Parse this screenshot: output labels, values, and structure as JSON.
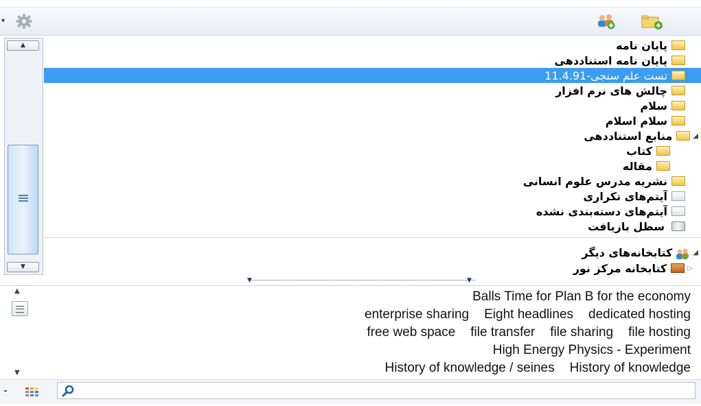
{
  "toolbar": {
    "icons": [
      "dropdown-arrow-icon",
      "gear-icon",
      "new-group-icon",
      "new-collection-icon"
    ]
  },
  "tree": {
    "items": [
      {
        "label": "پایان نامه",
        "icon": "folder-icon",
        "selected": false
      },
      {
        "label": "پایان نامه استناددهی",
        "icon": "folder-icon",
        "selected": false
      },
      {
        "label": "تست علم سنجی-11.4.91",
        "icon": "folder-icon",
        "selected": true
      },
      {
        "label": "چالش های نرم افزار",
        "icon": "folder-icon",
        "selected": false
      },
      {
        "label": "سلام",
        "icon": "folder-icon",
        "selected": false
      },
      {
        "label": "سلام اسلام",
        "icon": "folder-icon",
        "selected": false
      },
      {
        "label": "منابع استناددهی",
        "icon": "folder-icon",
        "selected": false,
        "expanded": true
      },
      {
        "label": "کتاب",
        "icon": "folder-icon",
        "selected": false,
        "indent": 1
      },
      {
        "label": "مقاله",
        "icon": "folder-icon",
        "selected": false,
        "indent": 1
      },
      {
        "label": "نشریه مدرس علوم انسانی",
        "icon": "folder-icon",
        "selected": false
      },
      {
        "label": "آیتم‌های تکراری",
        "icon": "duplicate-items-icon",
        "selected": false
      },
      {
        "label": "آیتم‌های دسته‌بندی نشده",
        "icon": "unfiled-items-icon",
        "selected": false
      },
      {
        "label": "سطل بازیافت",
        "icon": "trash-icon",
        "selected": false
      }
    ],
    "groups": [
      {
        "label": "کتابخانه‌های دیگر",
        "icon": "group-libraries-icon",
        "expanded": true
      },
      {
        "label": "کتابخانه مرکز نور",
        "icon": "library-icon",
        "expanded": false
      }
    ]
  },
  "tags": {
    "lines": [
      [
        "Balls Time for Plan B for the economy"
      ],
      [
        "enterprise sharing",
        "Eight headlines",
        "dedicated hosting"
      ],
      [
        "free web space",
        "file transfer",
        "file sharing",
        "file hosting"
      ],
      [
        "High Energy Physics - Experiment"
      ],
      [
        "History of knowledge / seines",
        "History of knowledge"
      ]
    ]
  },
  "search": {
    "value": "",
    "placeholder": ""
  },
  "colors": {
    "selection": "#3b9cf2",
    "folder": "#f3c34a"
  }
}
